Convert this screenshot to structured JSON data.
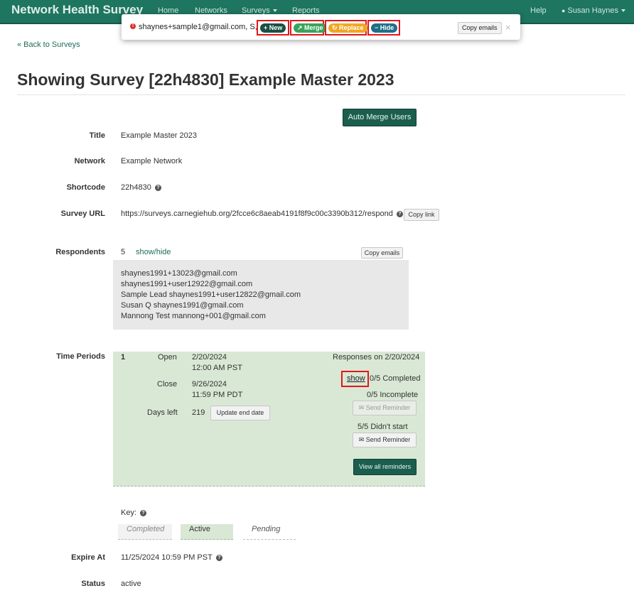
{
  "navbar": {
    "brand": "Network Health Survey",
    "links": [
      "Home",
      "Networks",
      "Surveys",
      "Reports"
    ],
    "help": "Help",
    "user": "Susan Haynes"
  },
  "alert": {
    "text": "shaynes+sample1@gmail.com, S, H",
    "new_label": "New",
    "merge_label": "Merge",
    "replace_label": "Replace",
    "hide_label": "Hide",
    "copy_label": "Copy emails",
    "close": "×"
  },
  "back_link": "« Back to Surveys",
  "page_title": "Showing Survey [22h4830] Example Master 2023",
  "auto_merge_label": "Auto Merge Users",
  "fields": {
    "title_label": "Title",
    "title_value": "Example Master 2023",
    "network_label": "Network",
    "network_value": "Example Network",
    "shortcode_label": "Shortcode",
    "shortcode_value": "22h4830",
    "url_label": "Survey URL",
    "url_value": "https://surveys.carnegiehub.org/2fcce6c8aeab4191f8f9c00c3390b312/respond",
    "copy_link_label": "Copy link",
    "respondents_label": "Respondents",
    "respondents_count": "5",
    "show_hide": "show/hide",
    "copy_emails_label": "Copy emails"
  },
  "emails": [
    "shaynes1991+13023@gmail.com",
    "shaynes1991+user12922@gmail.com",
    "Sample Lead shaynes1991+user12822@gmail.com",
    "Susan Q shaynes1991@gmail.com",
    "Mannong Test mannong+001@gmail.com"
  ],
  "time_periods": {
    "label": "Time Periods",
    "index": "1",
    "open_label": "Open",
    "open_date": "2/20/2024",
    "open_time": "12:00 AM PST",
    "close_label": "Close",
    "close_date": "9/26/2024",
    "close_time": "11:59 PM PDT",
    "days_left_label": "Days left",
    "days_left": "219",
    "update_end_label": "Update end date",
    "responses_on": "Responses on 2/20/2024",
    "show_label": "show",
    "completed": "0/5 Completed",
    "incomplete": "0/5 Incomplete",
    "send_reminder": "Send Reminder",
    "didnt_start": "5/5 Didn't start",
    "view_all": "View all reminders"
  },
  "key": {
    "label": "Key:",
    "completed": "Completed",
    "active": "Active",
    "pending": "Pending"
  },
  "expire_label": "Expire At",
  "expire_value": "11/25/2024 10:59 PM PST",
  "status_label": "Status",
  "status_value": "active",
  "colors": {
    "brand": "#1e7560",
    "highlight": "#e3161c",
    "active_period": "#d9e8d5"
  }
}
